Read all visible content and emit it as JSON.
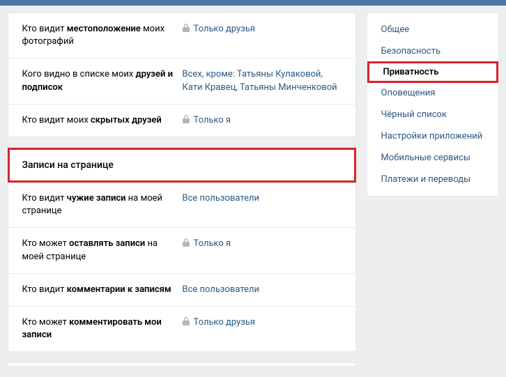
{
  "sections": {
    "top": [
      {
        "label_pre": "Кто видит ",
        "label_bold": "местоположение",
        "label_post": " моих фотографий",
        "value": "Только друзья",
        "locked": true
      },
      {
        "label_pre": "Кого видно в списке моих ",
        "label_bold": "друзей и подписок",
        "label_post": "",
        "value": "Всех, кроме: Татьяны Кулаковой, Кати Кравец, Татьяны Минченковой",
        "locked": false
      },
      {
        "label_pre": "Кто видит моих ",
        "label_bold": "скрытых друзей",
        "label_post": "",
        "value": "Только я",
        "locked": true
      }
    ],
    "wall_header": "Записи на странице",
    "wall": [
      {
        "label_pre": "Кто видит ",
        "label_bold": "чужие записи",
        "label_post": " на моей странице",
        "value": "Все пользователи",
        "locked": false
      },
      {
        "label_pre": "Кто может ",
        "label_bold": "оставлять записи",
        "label_post": " на моей странице",
        "value": "Только я",
        "locked": true
      },
      {
        "label_pre": "Кто видит ",
        "label_bold": "комментарии к записям",
        "label_post": "",
        "value": "Все пользователи",
        "locked": false
      },
      {
        "label_pre": "Кто может ",
        "label_bold": "комментировать мои записи",
        "label_post": "",
        "value": "Только друзья",
        "locked": true
      }
    ]
  },
  "sidebar": {
    "items": [
      "Общее",
      "Безопасность",
      "Приватность",
      "Оповещения",
      "Чёрный список",
      "Настройки приложений",
      "Мобильные сервисы",
      "Платежи и переводы"
    ],
    "active_index": 2,
    "highlight_index": 2
  }
}
